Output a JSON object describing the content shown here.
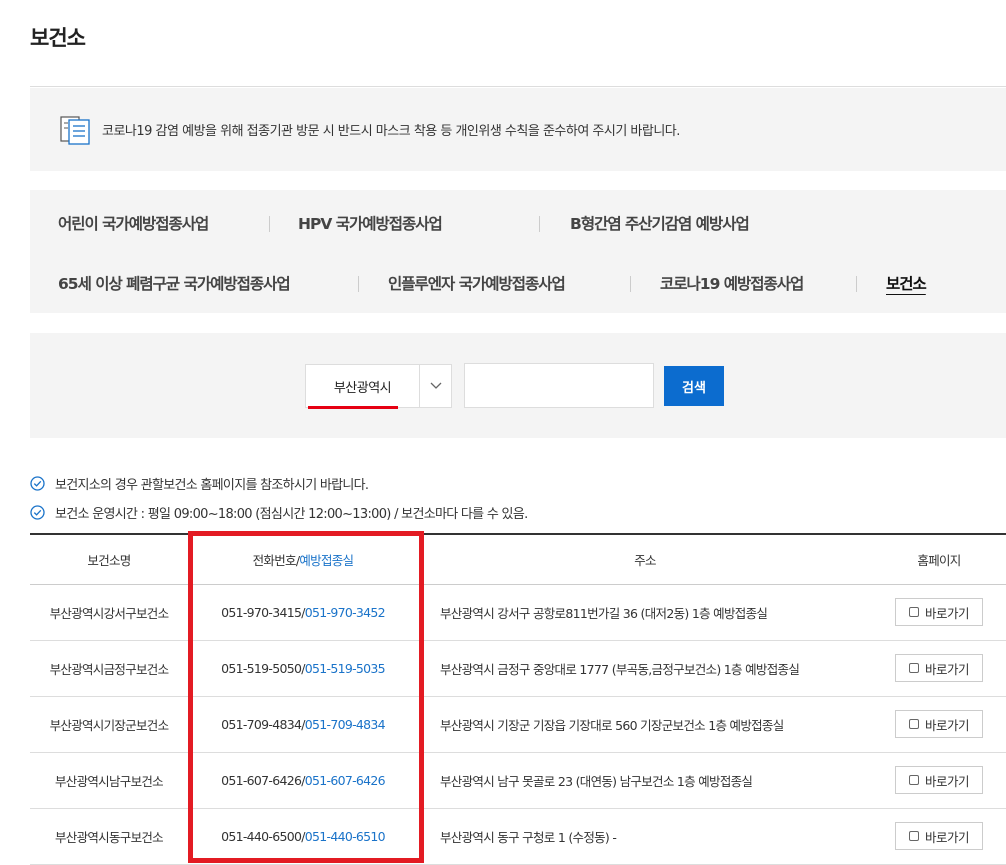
{
  "page": {
    "title": "보건소"
  },
  "notice": {
    "icon": "document-list-icon",
    "text": "코로나19 감염 예방을 위해 접종기관 방문 시 반드시 마스크 착용 등 개인위생 수칙을 준수하여 주시기 바랍니다."
  },
  "tabs": [
    {
      "label": "어린이 국가예방접종사업",
      "active": false
    },
    {
      "label": "HPV 국가예방접종사업",
      "active": false
    },
    {
      "label": "B형간염 주산기감염 예방사업",
      "active": false
    },
    {
      "label": "65세 이상 폐렴구균 국가예방접종사업",
      "active": false
    },
    {
      "label": "인플루엔자 국가예방접종사업",
      "active": false
    },
    {
      "label": "코로나19 예방접종사업",
      "active": false
    },
    {
      "label": "보건소",
      "active": true
    }
  ],
  "search": {
    "region_selected": "부산광역시",
    "input_value": "",
    "button_label": "검색",
    "underline_color": "#e60012",
    "button_color": "#0c6ccf"
  },
  "info": [
    "보건지소의 경우 관할보건소 홈페이지를 참조하시기 바랍니다.",
    "보건소 운영시간 : 평일 09:00~18:00 (점심시간 12:00~13:00) / 보건소마다 다를 수 있음."
  ],
  "table": {
    "headers": {
      "name": "보건소명",
      "phone": "전화번호",
      "phone_sep": "/",
      "vaccine_room": "예방접종실",
      "address": "주소",
      "homepage": "홈페이지"
    },
    "rows": [
      {
        "name": "부산광역시강서구보건소",
        "phone": "051-970-3415",
        "vaccine_phone": "051-970-3452",
        "address": "부산광역시 강서구 공항로811번가길 36 (대저2동) 1층 예방접종실",
        "link": "바로가기"
      },
      {
        "name": "부산광역시금정구보건소",
        "phone": "051-519-5050",
        "vaccine_phone": "051-519-5035",
        "address": "부산광역시 금정구 중앙대로 1777 (부곡동,금정구보건소) 1층 예방접종실",
        "link": "바로가기"
      },
      {
        "name": "부산광역시기장군보건소",
        "phone": "051-709-4834",
        "vaccine_phone": "051-709-4834",
        "address": "부산광역시 기장군 기장읍 기장대로 560 기장군보건소 1층 예방접종실",
        "link": "바로가기"
      },
      {
        "name": "부산광역시남구보건소",
        "phone": "051-607-6426",
        "vaccine_phone": "051-607-6426",
        "address": "부산광역시 남구 못골로 23 (대연동) 남구보건소 1층 예방접종실",
        "link": "바로가기"
      },
      {
        "name": "부산광역시동구보건소",
        "phone": "051-440-6500",
        "vaccine_phone": "051-440-6510",
        "address": "부산광역시 동구 구청로 1 (수정동) -",
        "link": "바로가기"
      }
    ]
  },
  "colors": {
    "highlight": "#e31b23",
    "link_blue": "#1a73c9"
  }
}
